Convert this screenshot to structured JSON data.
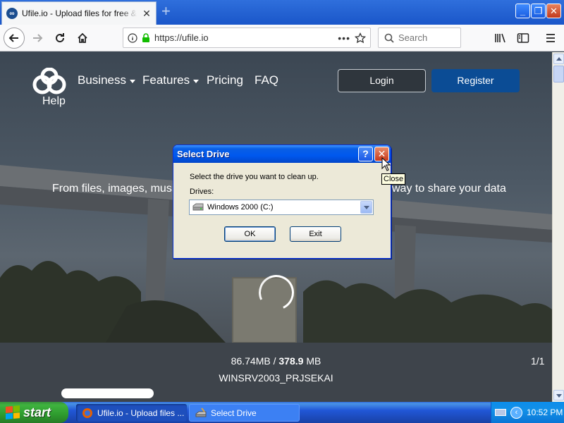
{
  "browser": {
    "tab_title": "Ufile.io - Upload files for free & sh",
    "tab_close": "✕",
    "new_tab": "+",
    "url": "https://ufile.io",
    "search_placeholder": "Search",
    "window_buttons": {
      "minimize": "_",
      "maximize": "❐",
      "close": "✕"
    }
  },
  "site": {
    "logo_icon": "ufile-cloud-logo",
    "help": "Help",
    "nav": {
      "business": "Business",
      "features": "Features",
      "pricing": "Pricing",
      "faq": "FAQ"
    },
    "login": "Login",
    "register": "Register",
    "tagline_left": "From files, images, musi",
    "tagline_right": "way to share your data",
    "progress_uploaded": "86.74MB",
    "progress_separator": "/",
    "progress_total": "378.9",
    "progress_unit": "MB",
    "page_counter": "1/1",
    "filename": "WINSRV2003_PRJSEKAI"
  },
  "dialog": {
    "title": "Select Drive",
    "help_button": "?",
    "close_button": "✕",
    "prompt": "Select the drive you want to clean up.",
    "drives_label": "Drives:",
    "drives_value": "Windows 2000 (C:)",
    "ok": "OK",
    "exit": "Exit",
    "tooltip": "Close"
  },
  "taskbar": {
    "start": "start",
    "tasks": [
      {
        "label": "Ufile.io - Upload files ...",
        "icon": "firefox-icon"
      },
      {
        "label": "Select Drive",
        "icon": "disk-cleanup-icon"
      }
    ],
    "clock": "10:52 PM"
  },
  "colors": {
    "xp_title_blue": "#0058ee",
    "register_blue": "#0b4c95",
    "start_green": "#3fb33f",
    "taskbar_blue": "#2157d7"
  }
}
